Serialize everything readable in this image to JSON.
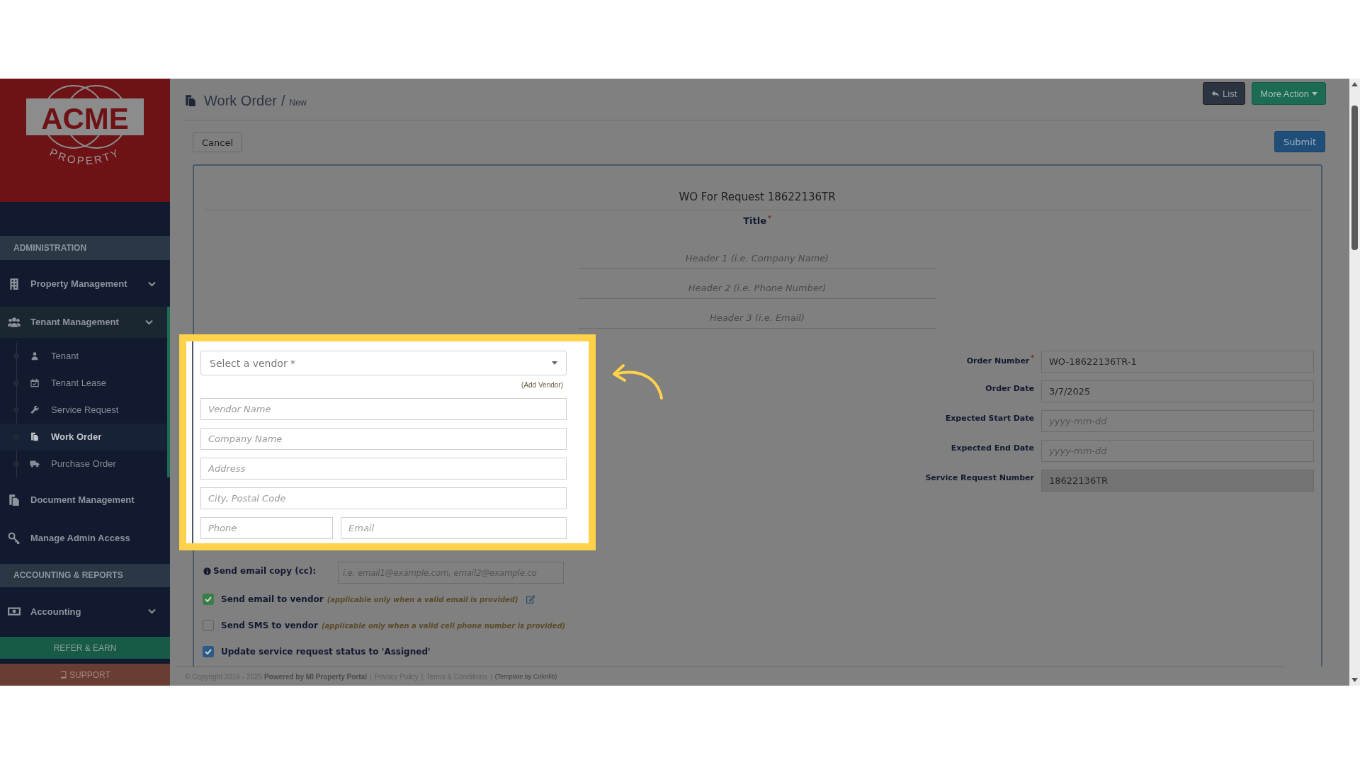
{
  "sidebar": {
    "logo": {
      "name": "ACME",
      "tagline": "PROPERTY"
    },
    "sections": [
      {
        "heading": "ADMINISTRATION",
        "items": [
          {
            "label": "Property Management",
            "kind": "group",
            "expanded": false
          },
          {
            "label": "Tenant Management",
            "kind": "group",
            "expanded": true,
            "children": [
              {
                "label": "Tenant",
                "selected": false
              },
              {
                "label": "Tenant Lease",
                "selected": false
              },
              {
                "label": "Service Request",
                "selected": false
              },
              {
                "label": "Work Order",
                "selected": true
              },
              {
                "label": "Purchase Order",
                "selected": false
              }
            ]
          },
          {
            "label": "Document Management",
            "kind": "link"
          },
          {
            "label": "Manage Admin Access",
            "kind": "link"
          }
        ]
      },
      {
        "heading": "ACCOUNTING & REPORTS",
        "items": [
          {
            "label": "Accounting",
            "kind": "group",
            "expanded": false
          }
        ]
      }
    ],
    "buttons": [
      {
        "label": "REFER & EARN",
        "kind": "refer"
      },
      {
        "label": "SUPPORT",
        "kind": "support"
      }
    ]
  },
  "header": {
    "title": "Work Order",
    "separator": "/",
    "subtitle": "New",
    "buttons": [
      {
        "label": "List",
        "kind": "dark"
      },
      {
        "label": "More Action",
        "kind": "success"
      }
    ]
  },
  "toolbar": {
    "cancel": "Cancel",
    "submit": "Submit"
  },
  "form": {
    "heading": "WO For Request 18622136TR",
    "title_label": "Title",
    "title_required": true,
    "required_mark": "*",
    "header_fields": [
      {
        "placeholder": "Header 1 (i.e. Company Name)"
      },
      {
        "placeholder": "Header 2 (i.e. Phone Number)"
      },
      {
        "placeholder": "Header 3 (i.e. Email)"
      }
    ],
    "vendor": {
      "select_placeholder": "Select a vendor *",
      "add_link": "(Add Vendor)",
      "rows": [
        {
          "fields": [
            {
              "placeholder": "Vendor Name"
            }
          ]
        },
        {
          "fields": [
            {
              "placeholder": "Company Name"
            }
          ]
        },
        {
          "fields": [
            {
              "placeholder": "Address"
            }
          ]
        },
        {
          "fields": [
            {
              "placeholder": "City, Postal Code"
            }
          ]
        },
        {
          "fields": [
            {
              "placeholder": "Phone"
            },
            {
              "placeholder": "Email"
            }
          ]
        }
      ]
    },
    "cc": {
      "label": "Send email copy (cc):",
      "placeholder": "i.e. email1@example.com, email2@example.co"
    },
    "checkboxes": [
      {
        "label": "Send email to vendor",
        "note": "(applicable only when a valid email is provided)",
        "checked": true,
        "color": "#3a7d48",
        "edit": true
      },
      {
        "label": "Send SMS to vendor",
        "note": "(applicable only when a valid cell phone number is provided)",
        "checked": false,
        "edit": false
      },
      {
        "label": "Update service request status to 'Assigned'",
        "checked": true,
        "color": "#2a5a88",
        "edit": false
      }
    ],
    "details": [
      {
        "label": "Order Number",
        "required": true,
        "readonly": false,
        "value": "WO-18622136TR-1"
      },
      {
        "label": "Order Date",
        "required": false,
        "readonly": false,
        "value": "3/7/2025"
      },
      {
        "label": "Expected Start Date",
        "required": false,
        "readonly": false,
        "placeholder": "yyyy-mm-dd"
      },
      {
        "label": "Expected End Date",
        "required": false,
        "readonly": false,
        "placeholder": "yyyy-mm-dd"
      },
      {
        "label": "Service Request Number",
        "required": false,
        "readonly": true,
        "value": "18622136TR"
      }
    ]
  },
  "footer": {
    "copyright": "© Copyright 2016 - 2025 **Powered by MI Property Portal**",
    "separator": "|",
    "links": [
      "Privacy Policy",
      "Terms & Conditions"
    ],
    "credit": "(Template by Colorlib)"
  }
}
